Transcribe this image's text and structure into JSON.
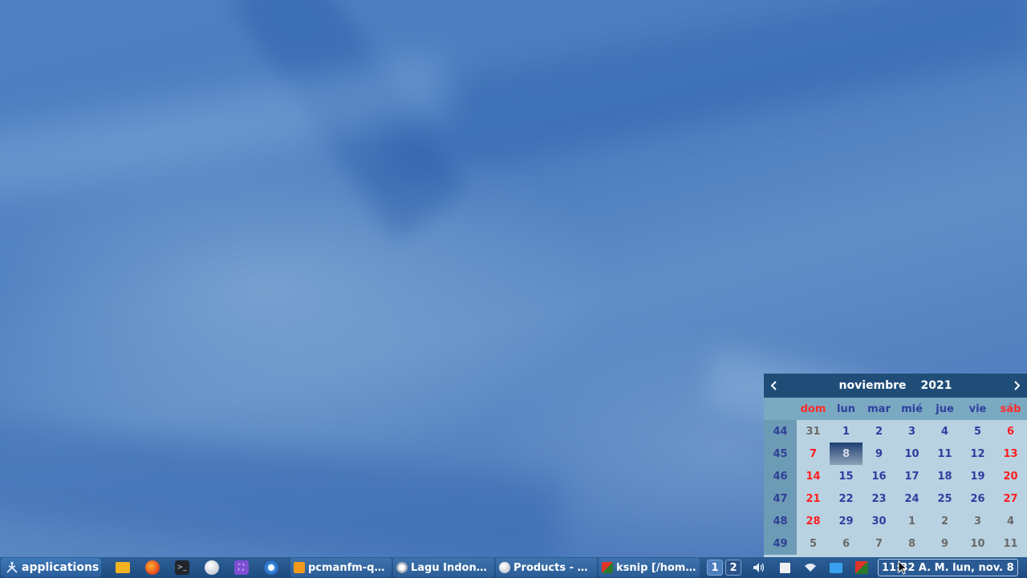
{
  "calendar": {
    "month": "noviembre",
    "year": "2021",
    "prev_label": "‹",
    "next_label": "›",
    "weekday_headers": [
      "dom",
      "lun",
      "mar",
      "mié",
      "jue",
      "vie",
      "sáb"
    ],
    "weeks": [
      {
        "week": "44",
        "days": [
          "31",
          "1",
          "2",
          "3",
          "4",
          "5",
          "6"
        ]
      },
      {
        "week": "45",
        "days": [
          "7",
          "8",
          "9",
          "10",
          "11",
          "12",
          "13"
        ]
      },
      {
        "week": "46",
        "days": [
          "14",
          "15",
          "16",
          "17",
          "18",
          "19",
          "20"
        ]
      },
      {
        "week": "47",
        "days": [
          "21",
          "22",
          "23",
          "24",
          "25",
          "26",
          "27"
        ]
      },
      {
        "week": "48",
        "days": [
          "28",
          "29",
          "30",
          "1",
          "2",
          "3",
          "4"
        ]
      },
      {
        "week": "49",
        "days": [
          "5",
          "6",
          "7",
          "8",
          "9",
          "10",
          "11"
        ]
      }
    ],
    "today": "8",
    "colors": {
      "header_bg": "#1f4d78",
      "weekday": "#2e3f9e",
      "weekend": "#ff1e1e",
      "other_month": "#6a6a6a"
    }
  },
  "taskbar": {
    "start_label": "applications",
    "quick_launch": [
      "folder-icon",
      "firefox-icon",
      "terminal-icon",
      "globe-icon",
      "screenshot-icon",
      "browser-icon"
    ],
    "tasks": [
      {
        "label": "pcmanfm-qt ...",
        "icon": "folder-icon"
      },
      {
        "label": "Lagu Indones...",
        "icon": "gear-icon"
      },
      {
        "label": "Products - pli...",
        "icon": "globe-icon"
      },
      {
        "label": "ksnip [/home...",
        "icon": "ksnip-icon"
      }
    ],
    "desktops": [
      "1",
      "2"
    ],
    "tray": [
      "volume-icon",
      "clipboard-icon",
      "wifi-icon",
      "chat-icon",
      "ksnip-icon"
    ],
    "clock": "11:32 A. M. lun, nov. 8"
  }
}
